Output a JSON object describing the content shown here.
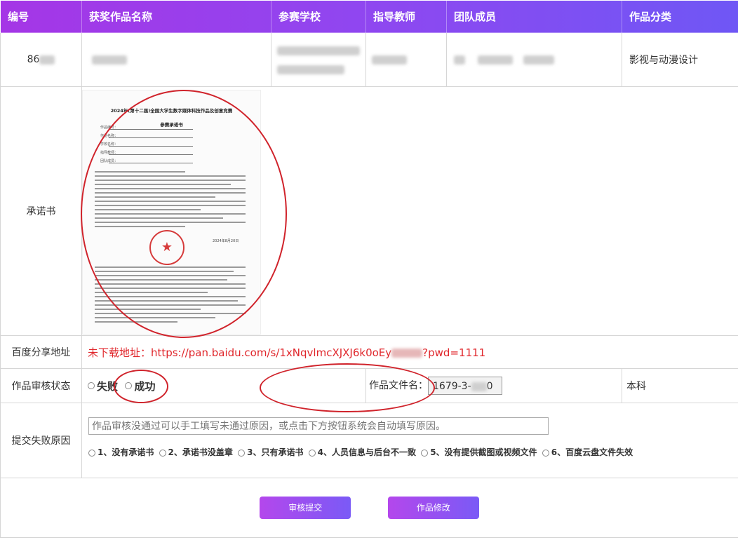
{
  "headers": [
    "编号",
    "获奖作品名称",
    "参赛学校",
    "指导教师",
    "团队成员",
    "作品分类"
  ],
  "entry": {
    "id_visible": "86",
    "id_tail": "",
    "category": "影视与动漫设计"
  },
  "labels": {
    "pledge": "承诺书",
    "share": "百度分享地址",
    "status": "作品审核状态",
    "reason": "提交失败原因"
  },
  "pledge_doc": {
    "title": "2024年(第十二届)全国大学生数字媒体科技作品及创意竞赛",
    "subtitle": "参赛承诺书",
    "fields": [
      "作品编号：",
      "作品名称：",
      "学校名称：",
      "指导教师：",
      "团队成员："
    ],
    "date": "2024年8月20日",
    "seal": "★"
  },
  "share_url": "未下载地址：https://pan.baidu.com/s/1xNqvlmcXJXJ6k0oEy",
  "share_url_tail": "pwd=1111",
  "status": {
    "fail": "失败",
    "success": "成功",
    "file_label": "作品文件名：",
    "file_value": "1679-3-",
    "file_tail": "0",
    "degree": "本科"
  },
  "reason": {
    "placeholder": "作品审核没通过可以手工填写未通过原因，或点击下方按钮系统会自动填写原因。",
    "options": [
      "1、没有承诺书",
      "2、承诺书没盖章",
      "3、只有承诺书",
      "4、人员信息与后台不一致",
      "5、没有提供截图或视频文件",
      "6、百度云盘文件失效"
    ]
  },
  "buttons": {
    "submit": "审核提交",
    "edit": "作品修改"
  },
  "colors": {
    "header_start": "#a536e6",
    "header_end": "#6f57f5",
    "link_red": "#e0262b",
    "annotation": "#d0232b"
  }
}
